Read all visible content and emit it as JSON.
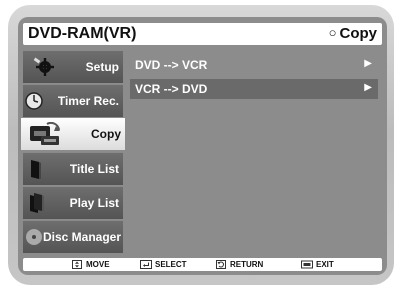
{
  "header": {
    "title": "DVD-RAM(VR)",
    "current_mode": "Copy"
  },
  "sidebar": {
    "items": [
      {
        "label": "Setup",
        "icon": "wrench-gear-icon",
        "active": false
      },
      {
        "label": "Timer Rec.",
        "icon": "clock-icon",
        "active": false
      },
      {
        "label": "Copy",
        "icon": "copy-cassette-icon",
        "active": true
      },
      {
        "label": "Title List",
        "icon": "title-list-icon",
        "active": false
      },
      {
        "label": "Play List",
        "icon": "play-list-icon",
        "active": false
      },
      {
        "label": "Disc Manager",
        "icon": "disc-icon",
        "active": false
      }
    ]
  },
  "menu": {
    "items": [
      {
        "label": "DVD --> VCR",
        "selected": false
      },
      {
        "label": "VCR --> DVD",
        "selected": true
      }
    ],
    "arrow_glyph": "▶"
  },
  "footer": {
    "move": "MOVE",
    "select": "SELECT",
    "return": "RETURN",
    "exit": "EXIT"
  },
  "colors": {
    "screen_bg": "#8c8c8c",
    "sidebar_bg": "#5a5a5a",
    "selected_row": "#6a6a6a",
    "bezel": "#c8c8c8"
  }
}
